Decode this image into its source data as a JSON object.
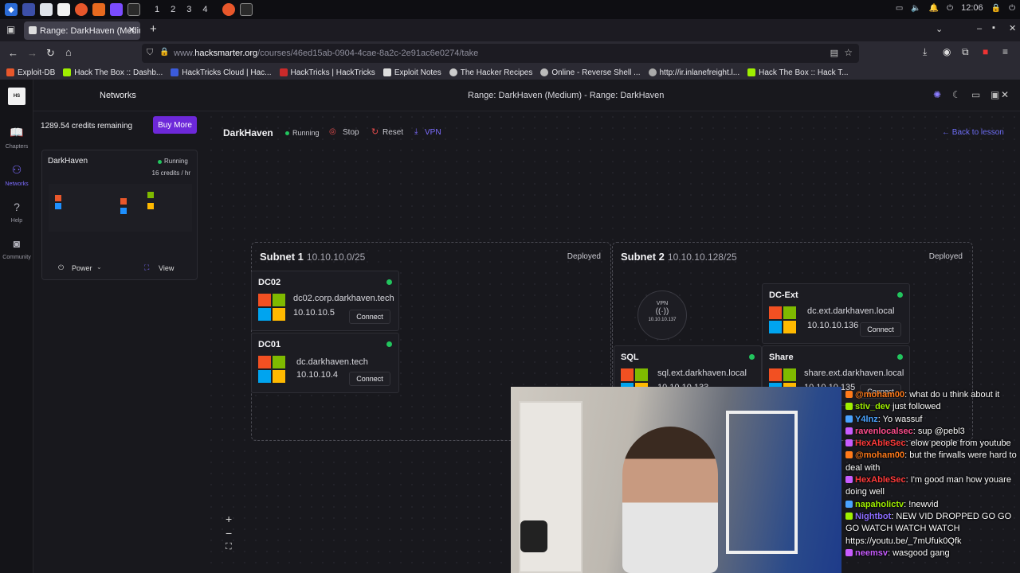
{
  "taskbar": {
    "workspaces": [
      "1",
      "2",
      "3",
      "4"
    ],
    "clock": "12:06"
  },
  "browser": {
    "tab_title": "Range: DarkHaven (Mediu",
    "url_prefix": "www.",
    "url_domain": "hacksmarter.org",
    "url_path": "/courses/46ed15ab-0904-4cae-8a2c-2e91ac6e0274/take",
    "bookmarks": [
      {
        "label": "Exploit-DB",
        "color": "#e8572b"
      },
      {
        "label": "Hack The Box :: Dashb...",
        "color": "#9fef00"
      },
      {
        "label": "HackTricks Cloud | Hac...",
        "color": "#3b5bdb"
      },
      {
        "label": "HackTricks | HackTricks",
        "color": "#c92a2a"
      },
      {
        "label": "Exploit Notes",
        "color": "#dddddd"
      },
      {
        "label": "The Hacker Recipes",
        "color": "#cccccc"
      },
      {
        "label": "Online - Reverse Shell ...",
        "color": "#bbbbbb"
      },
      {
        "label": "http://ir.inlanefreight.l...",
        "color": "#aaaaaa"
      },
      {
        "label": "Hack The Box :: Hack T...",
        "color": "#9fef00"
      }
    ]
  },
  "app": {
    "panel_title": "Networks",
    "page_title": "Range: DarkHaven (Medium) - Range: DarkHaven",
    "credits": "1289.54 credits remaining",
    "buy_more": "Buy More",
    "rail": [
      {
        "label": "Chapters",
        "icon": "book-icon"
      },
      {
        "label": "Networks",
        "icon": "network-icon"
      },
      {
        "label": "Help",
        "icon": "help-icon"
      },
      {
        "label": "Community",
        "icon": "discord-icon"
      }
    ],
    "range_card": {
      "name": "DarkHaven",
      "status": "Running",
      "rate": "16 credits / hr",
      "power": "Power",
      "view": "View"
    },
    "toolbar": {
      "name": "DarkHaven",
      "status": "Running",
      "stop": "Stop",
      "reset": "Reset",
      "vpn": "VPN",
      "back": "← Back to lesson"
    },
    "subnets": [
      {
        "title": "Subnet 1",
        "cidr": "10.10.10.0/25",
        "status": "Deployed"
      },
      {
        "title": "Subnet 2",
        "cidr": "10.10.10.128/25",
        "status": "Deployed"
      }
    ],
    "nodes": {
      "dc02": {
        "name": "DC02",
        "host": "dc02.corp.darkhaven.tech",
        "ip": "10.10.10.5",
        "action": "Connect"
      },
      "dc01": {
        "name": "DC01",
        "host": "dc.darkhaven.tech",
        "ip": "10.10.10.4",
        "action": "Connect"
      },
      "dcext": {
        "name": "DC-Ext",
        "host": "dc.ext.darkhaven.local",
        "ip": "10.10.10.136",
        "action": "Connect"
      },
      "sql": {
        "name": "SQL",
        "host": "sql.ext.darkhaven.local",
        "ip": "10.10.10.133"
      },
      "share": {
        "name": "Share",
        "host": "share.ext.darkhaven.local",
        "ip": "10.10.10.135",
        "action": "Connect"
      }
    },
    "vpn_node": {
      "label": "VPN",
      "ip": "10.10.10.137"
    },
    "zoom_controls": [
      "+",
      "−",
      "⛶"
    ]
  },
  "chat": [
    {
      "user": "@moham00",
      "user_color": "#ff7a1a",
      "text": ": what do u think about it"
    },
    {
      "user": "stiv_dev",
      "user_color": "#9fef00",
      "text": " just followed"
    },
    {
      "user": "Y4lnz",
      "user_color": "#4aa3ff",
      "text": ": Yo wassuf"
    },
    {
      "user": "ravenlocalsec",
      "user_color": "#ff4d8d",
      "text": ": sup @pebl3"
    },
    {
      "user": "HexAbleSec",
      "user_color": "#ff3b3b",
      "text": ": elow people from youtube"
    },
    {
      "user": "@moham00",
      "user_color": "#ff7a1a",
      "text": ": but the firwalls were hard to deal with"
    },
    {
      "user": "HexAbleSec",
      "user_color": "#ff3b3b",
      "text": ": I'm good man how youare doing well"
    },
    {
      "user": "napaholictv",
      "user_color": "#9fef00",
      "text": ": !newvid"
    },
    {
      "user": "Nightbot",
      "user_color": "#8c6cff",
      "text": ": NEW VID DROPPED GO GO GO WATCH WATCH WATCH https://youtu.be/_7mUfuk0Qfk"
    },
    {
      "user": "neemsv",
      "user_color": "#c85cff",
      "text": ": wasgood gang"
    }
  ]
}
